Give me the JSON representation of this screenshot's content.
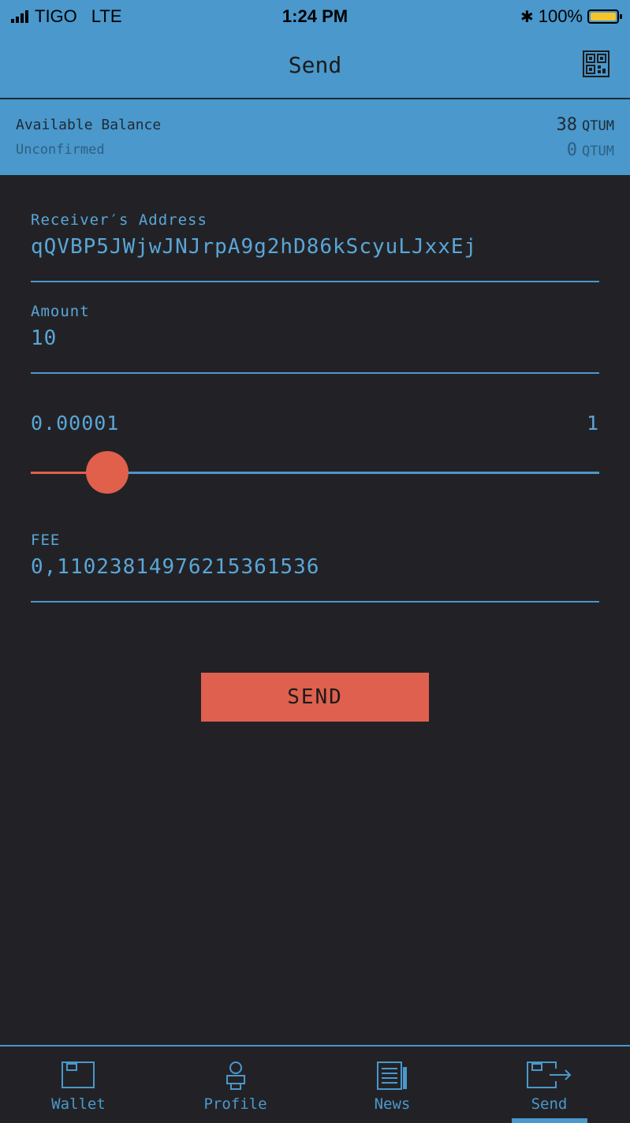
{
  "status_bar": {
    "carrier": "TIGO",
    "network": "LTE",
    "time": "1:24 PM",
    "battery_text": "100%",
    "battery_level": 1.0
  },
  "header": {
    "title": "Send",
    "qr_icon": "qr-code-icon"
  },
  "balance": {
    "available_label": "Available Balance",
    "available_amount": "38",
    "available_unit": "QTUM",
    "unconfirmed_label": "Unconfirmed",
    "unconfirmed_amount": "0",
    "unconfirmed_unit": "QTUM"
  },
  "form": {
    "address": {
      "label": "Receiver′s Address",
      "value": "qQVBP5JWjwJNJrpA9g2hD86kScyuLJxxEj"
    },
    "amount": {
      "label": "Amount",
      "value": "10"
    },
    "fee_slider": {
      "min_label": "0.00001",
      "max_label": "1",
      "level": 0.135
    },
    "fee": {
      "label": "FEE",
      "value": "0,11023814976215361536"
    },
    "send_label": "SEND"
  },
  "tabs": [
    {
      "label": "Wallet",
      "icon": "wallet-icon",
      "active": false
    },
    {
      "label": "Profile",
      "icon": "profile-icon",
      "active": false
    },
    {
      "label": "News",
      "icon": "news-icon",
      "active": false
    },
    {
      "label": "Send",
      "icon": "send-icon",
      "active": true
    }
  ],
  "colors": {
    "accent": "#4a98cc",
    "action": "#df604e",
    "background": "#222226"
  }
}
